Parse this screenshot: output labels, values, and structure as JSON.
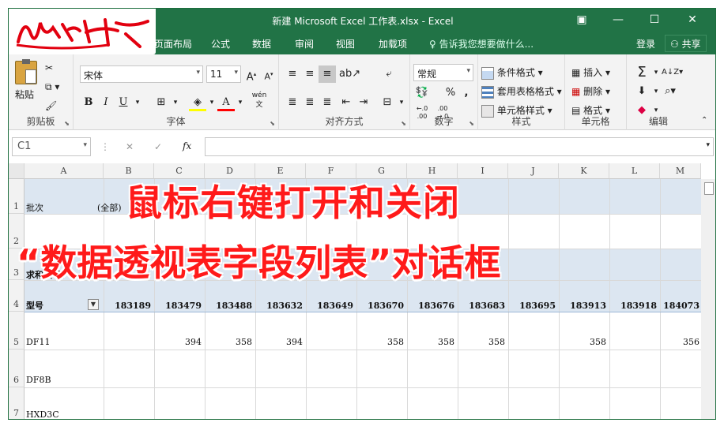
{
  "window": {
    "title": "新建 Microsoft Excel 工作表.xlsx - Excel",
    "logo_text": "峰之峰"
  },
  "tabs": [
    "页面布局",
    "公式",
    "数据",
    "审阅",
    "视图",
    "加载项"
  ],
  "tell_me": "告诉我您想要做什么...",
  "login": "登录",
  "share": "共享",
  "ribbon": {
    "clipboard": {
      "paste": "粘贴",
      "label": "剪贴板"
    },
    "font": {
      "name": "宋体",
      "size": "11",
      "bold": "B",
      "italic": "I",
      "underline": "U",
      "label": "字体",
      "color_a": "A",
      "increase": "A",
      "decrease": "A",
      "wen": "wén"
    },
    "align": {
      "label": "对齐方式"
    },
    "number": {
      "format": "常规",
      "percent": "%",
      "comma": ",",
      "label": "数字"
    },
    "styles": {
      "cond": "条件格式",
      "table": "套用表格格式",
      "cell": "单元格样式",
      "label": "样式"
    },
    "cells": {
      "insert": "插入",
      "delete": "删除",
      "format": "格式",
      "label": "单元格"
    },
    "edit": {
      "label": "编辑"
    }
  },
  "formula": {
    "name_box": "C1",
    "cancel": "✕",
    "enter": "✓",
    "fx": "fx"
  },
  "columns": [
    "A",
    "B",
    "C",
    "D",
    "E",
    "F",
    "G",
    "H",
    "I",
    "J",
    "K",
    "L",
    "M"
  ],
  "rows": [
    "1",
    "2",
    "3",
    "4",
    "5",
    "6",
    "7"
  ],
  "cells": {
    "a1": "批次",
    "b1": "(全部)",
    "a3": "求和项:",
    "a3b": "型",
    "a3c": "总",
    "a4": "型号",
    "a5": "DF11",
    "a6": "DF8B",
    "a7": "HXD3C"
  },
  "header_row": [
    "183189",
    "183479",
    "183488",
    "183632",
    "183649",
    "183670",
    "183676",
    "183683",
    "183695",
    "183913",
    "183918",
    "184073"
  ],
  "row5": [
    "",
    "394",
    "358",
    "394",
    "",
    "358",
    "358",
    "358",
    "",
    "358",
    "",
    "356"
  ],
  "overlay": {
    "line1": "鼠标右键打开和关闭",
    "line2": "“数据透视表字段列表”对话框"
  },
  "colors": {
    "excel_green": "#217346",
    "overlay_red": "#ff1a1a",
    "pivot_band": "#dce6f1"
  }
}
